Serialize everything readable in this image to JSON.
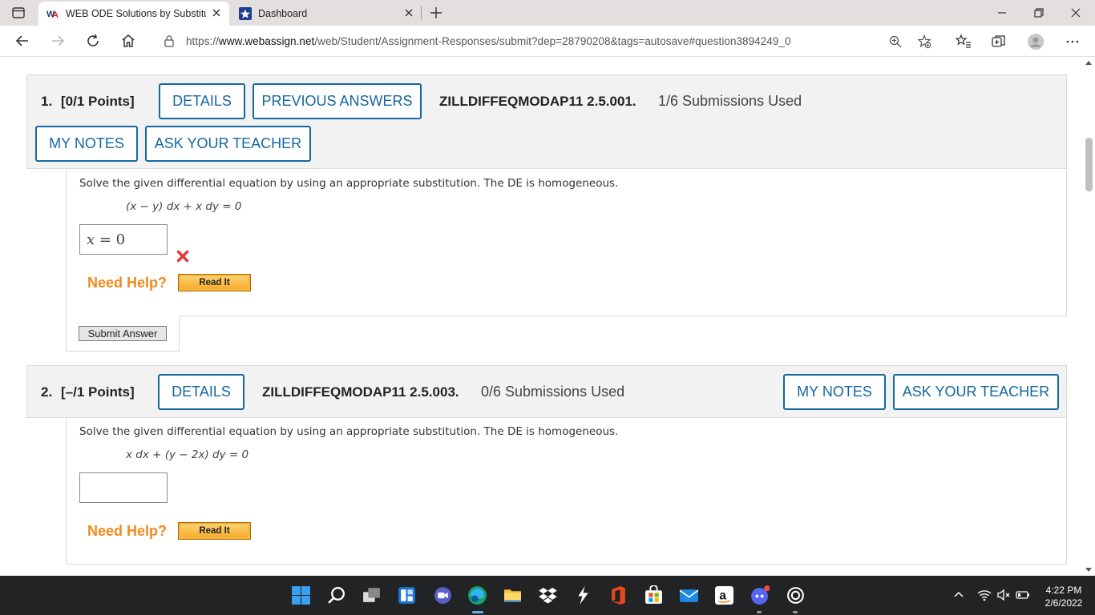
{
  "browser": {
    "tabs": [
      {
        "title": "WEB ODE Solutions by Substituti",
        "favicon": "webassign-logo",
        "active": true
      },
      {
        "title": "Dashboard",
        "favicon": "dashboard-star-icon",
        "active": false
      }
    ],
    "url_scheme": "https://",
    "url_host": "www.webassign.net",
    "url_path": "/web/Student/Assignment-Responses/submit?dep=28790208&tags=autosave#question3894249_0"
  },
  "questions": [
    {
      "number": "1.",
      "points": "[0/1 Points]",
      "details_label": "DETAILS",
      "previous_answers_label": "PREVIOUS ANSWERS",
      "code": "ZILLDIFFEQMODAP11 2.5.001.",
      "submissions": "1/6 Submissions Used",
      "my_notes_label": "MY NOTES",
      "ask_teacher_label": "ASK YOUR TEACHER",
      "prompt": "Solve the given differential equation by using an appropriate substitution. The DE is homogeneous.",
      "equation": "(x − y) dx + x dy = 0",
      "answer_var": "x",
      "answer_rest": " = 0",
      "answer_status": "incorrect",
      "need_help": "Need Help?",
      "read_it": "Read It",
      "submit_label": "Submit Answer"
    },
    {
      "number": "2.",
      "points": "[–/1 Points]",
      "details_label": "DETAILS",
      "code": "ZILLDIFFEQMODAP11 2.5.003.",
      "submissions": "0/6 Submissions Used",
      "my_notes_label": "MY NOTES",
      "ask_teacher_label": "ASK YOUR TEACHER",
      "prompt": "Solve the given differential equation by using an appropriate substitution. The DE is homogeneous.",
      "equation": "x dx + (y − 2x) dy = 0",
      "answer_value": "",
      "need_help": "Need Help?",
      "read_it": "Read It"
    }
  ],
  "taskbar": {
    "time": "4:22 PM",
    "date": "2/6/2022"
  },
  "colors": {
    "webassign_blue": "#15679f",
    "need_help_orange": "#f08a1c",
    "error_red": "#e23b3b",
    "taskbar_bg": "#222325"
  }
}
